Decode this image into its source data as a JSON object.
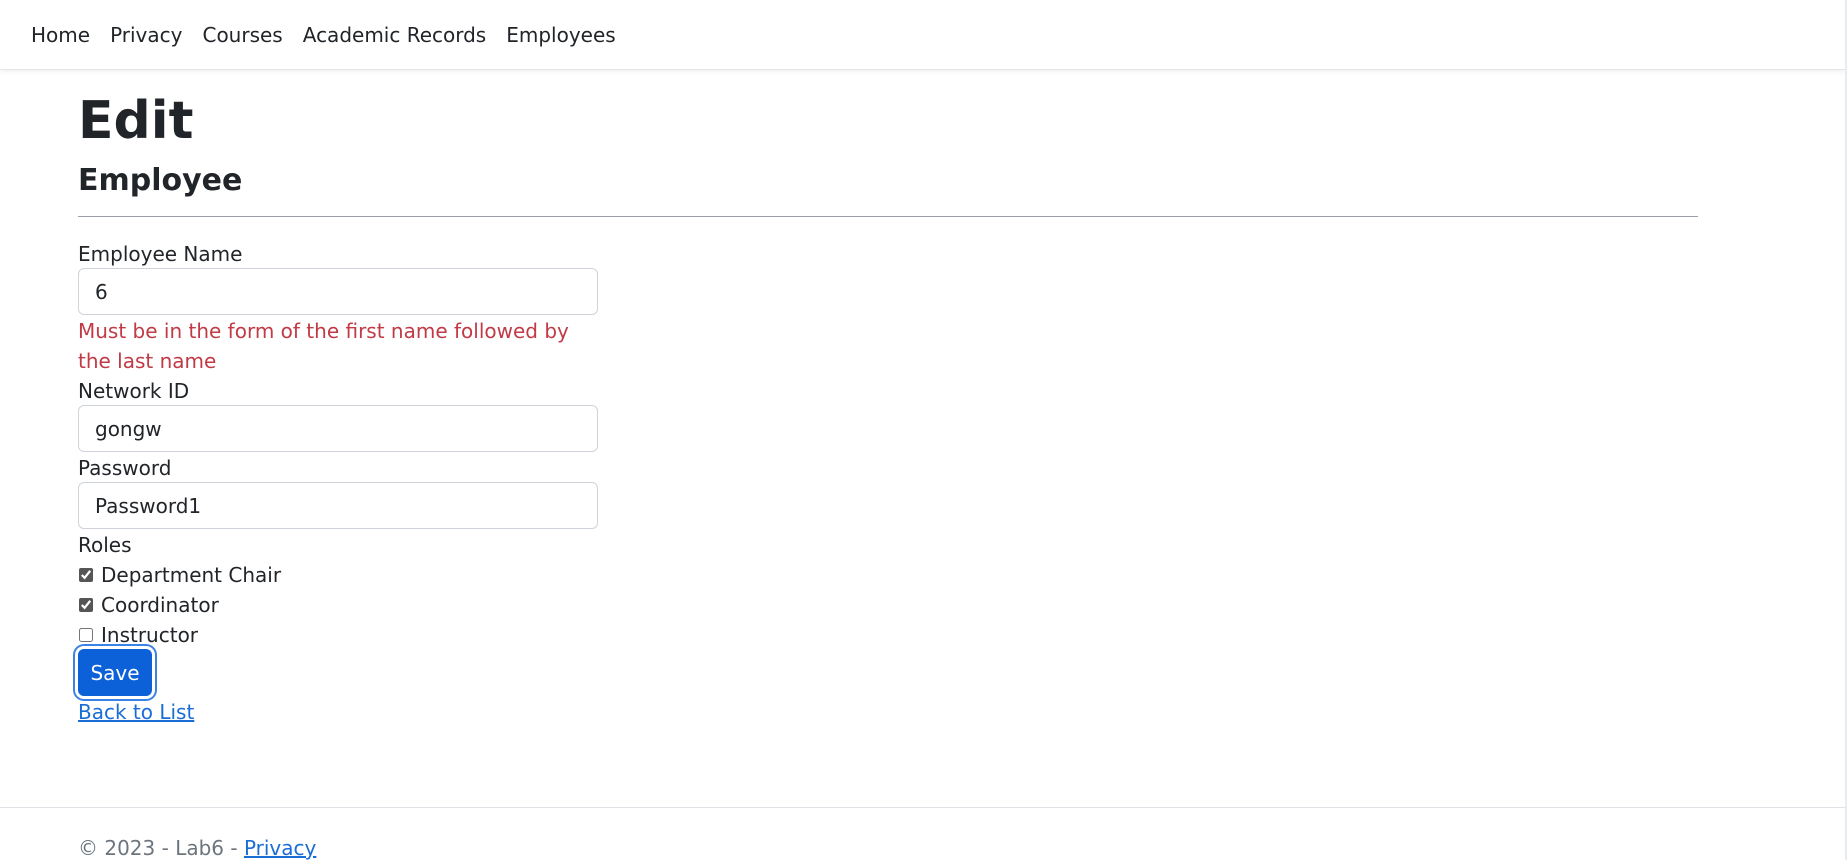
{
  "nav": {
    "items": [
      "Home",
      "Privacy",
      "Courses",
      "Academic Records",
      "Employees"
    ]
  },
  "page": {
    "title": "Edit",
    "subtitle": "Employee"
  },
  "form": {
    "name_label": "Employee Name",
    "name_value": "6",
    "name_error": "Must be in the form of the first name followed by the last name",
    "network_label": "Network ID",
    "network_value": "gongw",
    "password_label": "Password",
    "password_value": "Password1",
    "roles_label": "Roles",
    "roles": [
      {
        "label": "Department Chair",
        "checked": true
      },
      {
        "label": "Coordinator",
        "checked": true
      },
      {
        "label": "Instructor",
        "checked": false
      }
    ],
    "save_label": "Save",
    "back_label": "Back to List"
  },
  "footer": {
    "text": "© 2023 - Lab6 - ",
    "privacy_label": "Privacy"
  },
  "colors": {
    "primary": "#0d61d8",
    "error": "#c13a45",
    "link": "#1a6dd6"
  }
}
